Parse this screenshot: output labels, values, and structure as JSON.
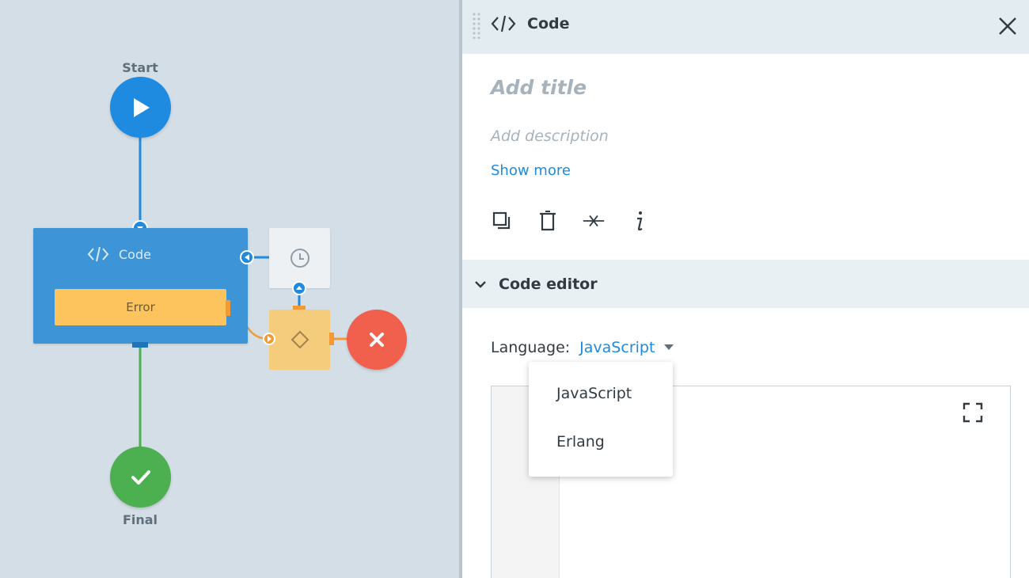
{
  "canvas": {
    "start_label": "Start",
    "final_label": "Final",
    "code_node_title": "Code",
    "error_label": "Error"
  },
  "panel": {
    "title": "Code",
    "add_title_placeholder": "Add title",
    "add_description_placeholder": "Add description",
    "show_more": "Show more",
    "toolbar_icons": [
      "copy-icon",
      "trash-icon",
      "disconnect-icon",
      "info-icon"
    ],
    "section_title": "Code editor",
    "language_label": "Language:",
    "language_value": "JavaScript",
    "language_options": [
      "JavaScript",
      "Erlang"
    ]
  },
  "colors": {
    "canvas_bg": "#d4dee6",
    "start_blue": "#1e8ae0",
    "code_node_blue": "#3d95d8",
    "error_yellow": "#fdc35d",
    "final_green": "#4caf50",
    "error_red": "#f0604d",
    "link_blue": "#1e8ae0"
  }
}
